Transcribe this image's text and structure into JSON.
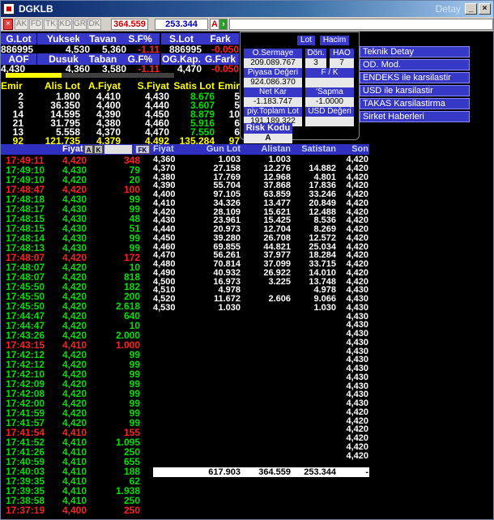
{
  "window": {
    "symbol": "DGKLB",
    "subtitle": "Detay"
  },
  "toolbar": {
    "buttons": [
      "AK",
      "FD",
      "TK",
      "KD",
      "GR",
      "DK"
    ],
    "value1": "364.559",
    "value2": "253.344",
    "a_label": "A"
  },
  "quote": {
    "headers1": [
      "G.Lot",
      "Yuksek",
      "Tavan",
      "S.F%",
      "S.Lot",
      "Fark"
    ],
    "values1": [
      "886995",
      "4,530",
      "5,360",
      "-1.11",
      "886995",
      "-0.050"
    ],
    "headers2": [
      "AOF",
      "Dusuk",
      "Taban",
      "G.F%",
      "OG.Kap.",
      "G.Fark"
    ],
    "values2": [
      "4,430",
      "4,360",
      "3,580",
      "-1.11",
      "4,470",
      "-0.050"
    ],
    "progress": 0.33
  },
  "book": {
    "headers": [
      "Emir",
      "Alis Lot",
      "A.Fiyat",
      "S.Fiyat",
      "Satis Lot",
      "Emir"
    ],
    "rows": [
      [
        "2",
        "1.800",
        "4,410",
        "4,430",
        "8.676",
        "5"
      ],
      [
        "3",
        "36.350",
        "4,400",
        "4,440",
        "3.607",
        "5"
      ],
      [
        "14",
        "14.595",
        "4,390",
        "4,450",
        "8.879",
        "10"
      ],
      [
        "21",
        "31.795",
        "4,380",
        "4,460",
        "5.916",
        "6"
      ],
      [
        "13",
        "5.558",
        "4,370",
        "4,470",
        "7.550",
        "6"
      ]
    ],
    "total": [
      "92",
      "121.735",
      "4,379",
      "4,492",
      "135.284",
      "97"
    ]
  },
  "summary": {
    "lot": "Lot",
    "hacim": "Hacim",
    "sermaye_label": "O.Sermaye",
    "sermaye": "209.089.767",
    "don_label": "Dön.",
    "don": "3",
    "hao_label": "HAO",
    "hao": "7",
    "piyasa_label": "Piyasa Değeri",
    "piyasa": "924.086.370",
    "fk_label": "F / K",
    "fk": "",
    "netkar_label": "Net Kar",
    "netkar": "-1.183.747",
    "sapma_label": "'Sapma",
    "sapma": "-1.0000",
    "toplam_label": "piy.Toplam Lot",
    "toplam": "191.189.322",
    "usd_label": "USD Değeri",
    "usd": "",
    "risk_label": "Risk Kodu",
    "risk": "A"
  },
  "menu": [
    "Teknik Detay",
    "OD. Mod.",
    "ENDEKS ile karsilastir",
    "USD ile karsilastir",
    "TAKAS Karsilastirma",
    "Sirket Haberleri"
  ],
  "trades": {
    "hdr_fiyat": "Fiyat",
    "hdr_fk": "FK",
    "mini": [
      "A",
      "K"
    ],
    "rows": [
      [
        "17:49:11",
        "4,420",
        "348",
        "r"
      ],
      [
        "17:49:10",
        "4,430",
        "79",
        "g"
      ],
      [
        "17:49:10",
        "4,420",
        "20",
        "g"
      ],
      [
        "17:48:47",
        "4,420",
        "100",
        "r"
      ],
      [
        "17:48:18",
        "4,430",
        "99",
        "g"
      ],
      [
        "17:48:17",
        "4,430",
        "99",
        "g"
      ],
      [
        "17:48:15",
        "4,430",
        "48",
        "g"
      ],
      [
        "17:48:15",
        "4,430",
        "51",
        "g"
      ],
      [
        "17:48:14",
        "4,430",
        "99",
        "g"
      ],
      [
        "17:48:13",
        "4,430",
        "99",
        "g"
      ],
      [
        "17:48:07",
        "4,420",
        "172",
        "r"
      ],
      [
        "17:48:07",
        "4,420",
        "10",
        "g"
      ],
      [
        "17:48:07",
        "4,420",
        "818",
        "g"
      ],
      [
        "17:45:50",
        "4,420",
        "182",
        "g"
      ],
      [
        "17:45:50",
        "4,420",
        "200",
        "g"
      ],
      [
        "17:45:50",
        "4,420",
        "2.618",
        "g"
      ],
      [
        "17:44:47",
        "4,420",
        "640",
        "g"
      ],
      [
        "17:44:47",
        "4,420",
        "10",
        "g"
      ],
      [
        "17:43:26",
        "4,420",
        "2.000",
        "g"
      ],
      [
        "17:43:15",
        "4,410",
        "1.000",
        "r"
      ],
      [
        "17:42:12",
        "4,420",
        "99",
        "g"
      ],
      [
        "17:42:12",
        "4,420",
        "99",
        "g"
      ],
      [
        "17:42:10",
        "4,420",
        "99",
        "g"
      ],
      [
        "17:42:09",
        "4,420",
        "99",
        "g"
      ],
      [
        "17:42:08",
        "4,420",
        "99",
        "g"
      ],
      [
        "17:42:00",
        "4,420",
        "99",
        "g"
      ],
      [
        "17:41:59",
        "4,420",
        "99",
        "g"
      ],
      [
        "17:41:57",
        "4,420",
        "99",
        "g"
      ],
      [
        "17:41:54",
        "4,410",
        "155",
        "r"
      ],
      [
        "17:41:52",
        "4,410",
        "1.095",
        "g"
      ],
      [
        "17:41:26",
        "4,410",
        "250",
        "g"
      ],
      [
        "17:40:59",
        "4,410",
        "655",
        "g"
      ],
      [
        "17:40:03",
        "4,410",
        "188",
        "g"
      ],
      [
        "17:39:35",
        "4,410",
        "62",
        "g"
      ],
      [
        "17:39:35",
        "4,410",
        "1.938",
        "g"
      ],
      [
        "17:38:58",
        "4,410",
        "250",
        "g"
      ],
      [
        "17:37:19",
        "4,400",
        "250",
        "r"
      ]
    ]
  },
  "depth": {
    "headers": [
      "Fiyat",
      "Gun Lot",
      "Alistan",
      "Satistan",
      "Son"
    ],
    "rows": [
      [
        "4,360",
        "1.003",
        "1.003",
        "",
        "4,420"
      ],
      [
        "4,370",
        "27.158",
        "12.276",
        "14.882",
        "4,420"
      ],
      [
        "4,380",
        "17.769",
        "12.968",
        "4.801",
        "4,420"
      ],
      [
        "4,390",
        "55.704",
        "37.868",
        "17.836",
        "4,420"
      ],
      [
        "4,400",
        "97.105",
        "63.859",
        "33.246",
        "4,420"
      ],
      [
        "4,410",
        "34.326",
        "13.477",
        "20.849",
        "4,420"
      ],
      [
        "4,420",
        "28.109",
        "15.621",
        "12.488",
        "4,420"
      ],
      [
        "4,430",
        "23.961",
        "15.425",
        "8.536",
        "4,420"
      ],
      [
        "4,440",
        "20.973",
        "12.704",
        "8.269",
        "4,420"
      ],
      [
        "4,450",
        "39.280",
        "26.708",
        "12.572",
        "4,420"
      ],
      [
        "4,460",
        "69.855",
        "44.821",
        "25.034",
        "4,420"
      ],
      [
        "4,470",
        "56.261",
        "37.977",
        "18.284",
        "4,420"
      ],
      [
        "4,480",
        "70.814",
        "37.099",
        "33.715",
        "4,420"
      ],
      [
        "4,490",
        "40.932",
        "26.922",
        "14.010",
        "4,420"
      ],
      [
        "4,500",
        "16.973",
        "3.225",
        "13.748",
        "4,420"
      ],
      [
        "4,510",
        "4.978",
        "",
        "4.978",
        "4,430"
      ],
      [
        "4,520",
        "11.672",
        "2.606",
        "9.066",
        "4,430"
      ],
      [
        "4,530",
        "1.030",
        "",
        "1.030",
        "4,430"
      ]
    ],
    "son_extra": [
      "4,430",
      "4,430",
      "4,430",
      "4,430",
      "4,430",
      "4,430",
      "4,430",
      "4,430",
      "4,430",
      "4,430",
      "4,430",
      "4,420",
      "4,420",
      "4,420",
      "4,420",
      "4,420",
      "4,420",
      "4,420",
      "4,420",
      "4,420",
      "4,420",
      "4,420",
      "4,420",
      "4,420",
      "4,420",
      "4,420",
      "4,420",
      "4,420",
      "4,420",
      "4,420",
      "4,420",
      "4,420",
      "4,420",
      "4,420",
      "4,420",
      "4,420",
      "4,420",
      "4,420",
      "4,420",
      "4,420",
      "4,420",
      "4,420",
      "4,420",
      "4,420",
      "4,420",
      "4,420",
      "4,420",
      "4,420",
      "4,420",
      "4,420",
      "4,420",
      "4,420",
      "4,420",
      "4,420",
      "4,420",
      "4,420",
      "4,420",
      "4,420",
      "4,420",
      "4,420",
      "4,420"
    ],
    "totals": [
      "617.903",
      "364.559",
      "253.344",
      "-"
    ]
  }
}
